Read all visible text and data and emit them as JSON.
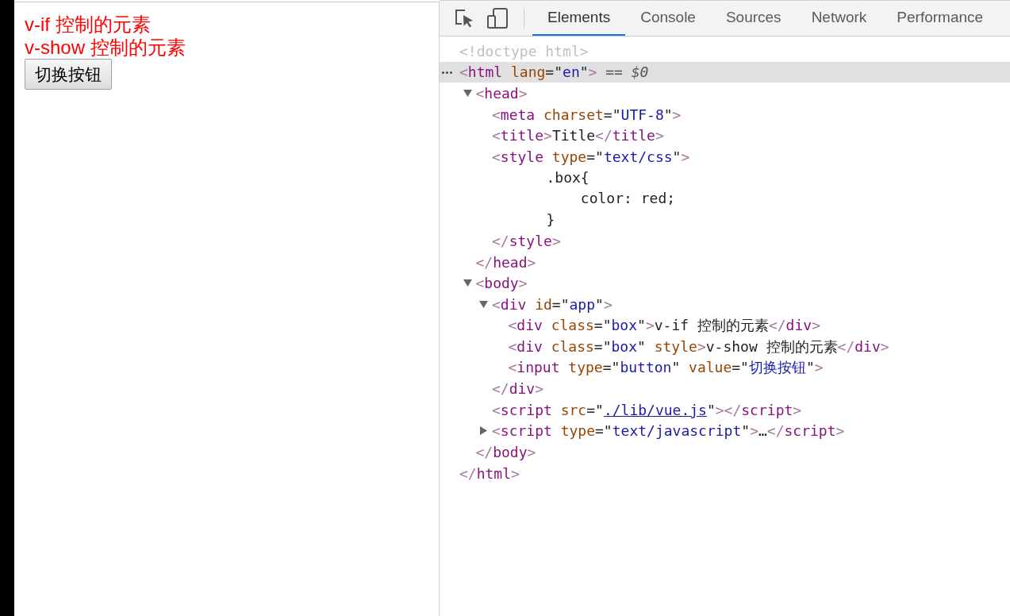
{
  "page": {
    "texts": [
      "v-if 控制的元素",
      "v-show 控制的元素"
    ],
    "button": "切换按钮"
  },
  "devtools": {
    "tabs": [
      {
        "label": "Elements",
        "selected": true
      },
      {
        "label": "Console",
        "selected": false
      },
      {
        "label": "Sources",
        "selected": false
      },
      {
        "label": "Network",
        "selected": false
      },
      {
        "label": "Performance",
        "selected": false
      }
    ],
    "dom_tree": [
      {
        "selected": false,
        "tokens": [
          {
            "kind": "doctype",
            "text": "<!doctype html>"
          }
        ]
      },
      {
        "selected": true,
        "tokens": [
          {
            "kind": "bracket",
            "text": "<"
          },
          {
            "kind": "tag",
            "text": "html"
          },
          {
            "kind": "attr",
            "text": "lang"
          },
          {
            "kind": "plain",
            "text": "=\""
          },
          {
            "kind": "value",
            "text": "en"
          },
          {
            "kind": "plain",
            "text": "\""
          },
          {
            "kind": "bracket",
            "text": ">"
          },
          {
            "kind": "hint",
            "text": " == $0"
          }
        ],
        "closing": [
          {
            "kind": "bracket",
            "text": "</"
          },
          {
            "kind": "tag",
            "text": "html"
          },
          {
            "kind": "bracket",
            "text": ">"
          }
        ],
        "children": [
          {
            "selected": false,
            "expanded": true,
            "tokens": [
              {
                "kind": "bracket",
                "text": "<"
              },
              {
                "kind": "tag",
                "text": "head"
              },
              {
                "kind": "bracket",
                "text": ">"
              }
            ],
            "closing": [
              {
                "kind": "bracket",
                "text": "</"
              },
              {
                "kind": "tag",
                "text": "head"
              },
              {
                "kind": "bracket",
                "text": ">"
              }
            ],
            "children": [
              {
                "selected": false,
                "tokens": [
                  {
                    "kind": "bracket",
                    "text": "<"
                  },
                  {
                    "kind": "tag",
                    "text": "meta"
                  },
                  {
                    "kind": "attr",
                    "text": "charset"
                  },
                  {
                    "kind": "plain",
                    "text": "=\""
                  },
                  {
                    "kind": "value",
                    "text": "UTF-8"
                  },
                  {
                    "kind": "plain",
                    "text": "\""
                  },
                  {
                    "kind": "bracket",
                    "text": ">"
                  }
                ]
              },
              {
                "selected": false,
                "tokens": [
                  {
                    "kind": "bracket",
                    "text": "<"
                  },
                  {
                    "kind": "tag",
                    "text": "title"
                  },
                  {
                    "kind": "bracket",
                    "text": ">"
                  },
                  {
                    "kind": "plain",
                    "text": "Title"
                  },
                  {
                    "kind": "bracket",
                    "text": "</"
                  },
                  {
                    "kind": "tag",
                    "text": "title"
                  },
                  {
                    "kind": "bracket",
                    "text": ">"
                  }
                ]
              },
              {
                "selected": false,
                "tokens": [
                  {
                    "kind": "bracket",
                    "text": "<"
                  },
                  {
                    "kind": "tag",
                    "text": "style"
                  },
                  {
                    "kind": "attr",
                    "text": "type"
                  },
                  {
                    "kind": "plain",
                    "text": "=\""
                  },
                  {
                    "kind": "value",
                    "text": "text/css"
                  },
                  {
                    "kind": "plain",
                    "text": "\""
                  },
                  {
                    "kind": "bracket",
                    "text": ">"
                  }
                ],
                "closing": [
                  {
                    "kind": "bracket",
                    "text": "</"
                  },
                  {
                    "kind": "tag",
                    "text": "style"
                  },
                  {
                    "kind": "bracket",
                    "text": ">"
                  }
                ],
                "children": [
                  {
                    "selected": false,
                    "lines": [
                      ".box{",
                      "    color: red;",
                      "}"
                    ]
                  }
                ]
              }
            ]
          },
          {
            "selected": false,
            "expanded": true,
            "tokens": [
              {
                "kind": "bracket",
                "text": "<"
              },
              {
                "kind": "tag",
                "text": "body"
              },
              {
                "kind": "bracket",
                "text": ">"
              }
            ],
            "closing": [
              {
                "kind": "bracket",
                "text": "</"
              },
              {
                "kind": "tag",
                "text": "body"
              },
              {
                "kind": "bracket",
                "text": ">"
              }
            ],
            "children": [
              {
                "selected": false,
                "expanded": true,
                "tokens": [
                  {
                    "kind": "bracket",
                    "text": "<"
                  },
                  {
                    "kind": "tag",
                    "text": "div"
                  },
                  {
                    "kind": "attr",
                    "text": "id"
                  },
                  {
                    "kind": "plain",
                    "text": "=\""
                  },
                  {
                    "kind": "value",
                    "text": "app"
                  },
                  {
                    "kind": "plain",
                    "text": "\""
                  },
                  {
                    "kind": "bracket",
                    "text": ">"
                  }
                ],
                "closing": [
                  {
                    "kind": "bracket",
                    "text": "</"
                  },
                  {
                    "kind": "tag",
                    "text": "div"
                  },
                  {
                    "kind": "bracket",
                    "text": ">"
                  }
                ],
                "children": [
                  {
                    "selected": false,
                    "tokens": [
                      {
                        "kind": "bracket",
                        "text": "<"
                      },
                      {
                        "kind": "tag",
                        "text": "div"
                      },
                      {
                        "kind": "attr",
                        "text": "class"
                      },
                      {
                        "kind": "plain",
                        "text": "=\""
                      },
                      {
                        "kind": "value",
                        "text": "box"
                      },
                      {
                        "kind": "plain",
                        "text": "\""
                      },
                      {
                        "kind": "bracket",
                        "text": ">"
                      },
                      {
                        "kind": "plain",
                        "text": "v-if 控制的元素"
                      },
                      {
                        "kind": "bracket",
                        "text": "</"
                      },
                      {
                        "kind": "tag",
                        "text": "div"
                      },
                      {
                        "kind": "bracket",
                        "text": ">"
                      }
                    ]
                  },
                  {
                    "selected": false,
                    "tokens": [
                      {
                        "kind": "bracket",
                        "text": "<"
                      },
                      {
                        "kind": "tag",
                        "text": "div"
                      },
                      {
                        "kind": "attr",
                        "text": "class"
                      },
                      {
                        "kind": "plain",
                        "text": "=\""
                      },
                      {
                        "kind": "value",
                        "text": "box"
                      },
                      {
                        "kind": "plain",
                        "text": "\""
                      },
                      {
                        "kind": "attr",
                        "text": "style"
                      },
                      {
                        "kind": "bracket",
                        "text": ">"
                      },
                      {
                        "kind": "plain",
                        "text": "v-show 控制的元素"
                      },
                      {
                        "kind": "bracket",
                        "text": "</"
                      },
                      {
                        "kind": "tag",
                        "text": "div"
                      },
                      {
                        "kind": "bracket",
                        "text": ">"
                      }
                    ]
                  },
                  {
                    "selected": false,
                    "tokens": [
                      {
                        "kind": "bracket",
                        "text": "<"
                      },
                      {
                        "kind": "tag",
                        "text": "input"
                      },
                      {
                        "kind": "attr",
                        "text": "type"
                      },
                      {
                        "kind": "plain",
                        "text": "=\""
                      },
                      {
                        "kind": "value",
                        "text": "button"
                      },
                      {
                        "kind": "plain",
                        "text": "\""
                      },
                      {
                        "kind": "attr",
                        "text": "value"
                      },
                      {
                        "kind": "plain",
                        "text": "=\""
                      },
                      {
                        "kind": "value",
                        "text": "切换按钮"
                      },
                      {
                        "kind": "plain",
                        "text": "\""
                      },
                      {
                        "kind": "bracket",
                        "text": ">"
                      }
                    ]
                  }
                ]
              },
              {
                "selected": false,
                "tokens": [
                  {
                    "kind": "bracket",
                    "text": "<"
                  },
                  {
                    "kind": "tag",
                    "text": "script"
                  },
                  {
                    "kind": "attr",
                    "text": "src"
                  },
                  {
                    "kind": "plain",
                    "text": "=\""
                  },
                  {
                    "kind": "link",
                    "text": "./lib/vue.js"
                  },
                  {
                    "kind": "plain",
                    "text": "\""
                  },
                  {
                    "kind": "bracket",
                    "text": "></"
                  },
                  {
                    "kind": "tag",
                    "text": "script"
                  },
                  {
                    "kind": "bracket",
                    "text": ">"
                  }
                ]
              },
              {
                "selected": false,
                "expanded": false,
                "tokens": [
                  {
                    "kind": "bracket",
                    "text": "<"
                  },
                  {
                    "kind": "tag",
                    "text": "script"
                  },
                  {
                    "kind": "attr",
                    "text": "type"
                  },
                  {
                    "kind": "plain",
                    "text": "=\""
                  },
                  {
                    "kind": "value",
                    "text": "text/javascript"
                  },
                  {
                    "kind": "plain",
                    "text": "\""
                  },
                  {
                    "kind": "bracket",
                    "text": ">"
                  },
                  {
                    "kind": "plain",
                    "text": "…"
                  },
                  {
                    "kind": "bracket",
                    "text": "</"
                  },
                  {
                    "kind": "tag",
                    "text": "script"
                  },
                  {
                    "kind": "bracket",
                    "text": ">"
                  }
                ]
              }
            ]
          }
        ]
      }
    ]
  }
}
